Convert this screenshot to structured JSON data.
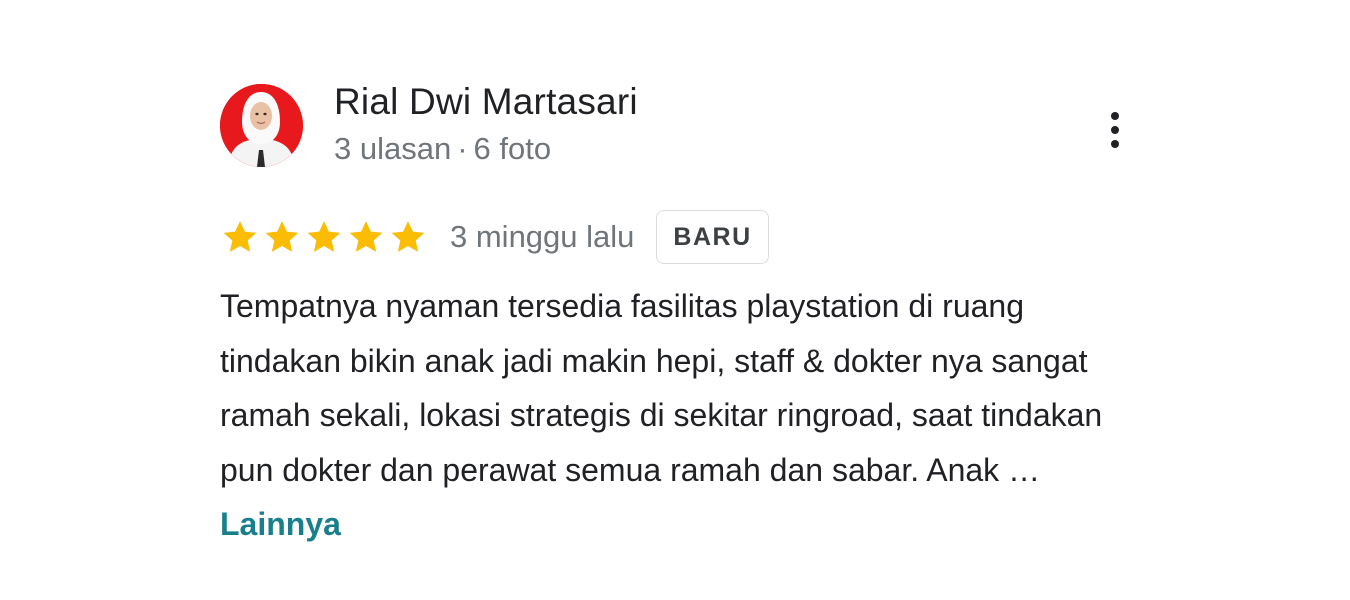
{
  "reviewer": {
    "name": "Rial Dwi Martasari",
    "reviews": "3 ulasan",
    "separator": "·",
    "photos": "6 foto"
  },
  "rating": {
    "stars": 5,
    "max": 5,
    "color": "#fbbc04"
  },
  "date": "3 minggu lalu",
  "badge": "BARU",
  "review": {
    "text": "Tempatnya nyaman tersedia fasilitas playstation di ruang tindakan bikin anak jadi makin hepi, staff & dokter nya sangat ramah sekali, lokasi strategis di sekitar ringroad, saat tindakan pun dokter dan perawat semua ramah dan sabar. Anak …",
    "more_label": "Lainnya"
  },
  "icons": {
    "menu": "more-vert-icon",
    "star": "star-icon"
  },
  "colors": {
    "text": "#202124",
    "secondary": "#70757a",
    "link": "#1a7f8c",
    "avatar_bg": "#e8191c"
  }
}
